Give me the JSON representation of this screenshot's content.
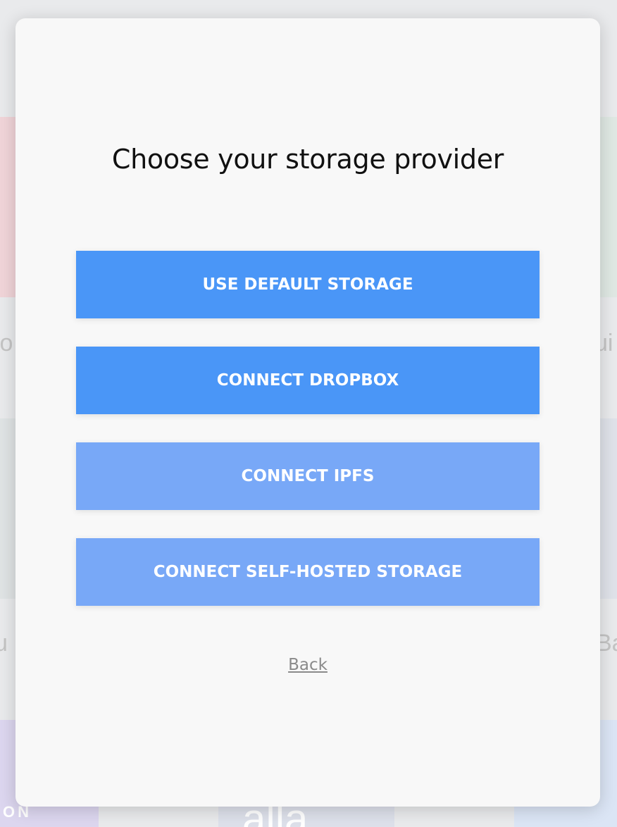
{
  "background": {
    "left_fragment_1": "lo",
    "right_fragment_1": "ui",
    "left_fragment_2": "u",
    "right_fragment_2": "Ba",
    "bottom_left_logo": "ON",
    "bottom_center_logo": "alla"
  },
  "modal": {
    "title": "Choose your storage provider",
    "buttons": [
      {
        "label": "USE DEFAULT STORAGE",
        "color": "#4a96f7"
      },
      {
        "label": "CONNECT DROPBOX",
        "color": "#4a96f7"
      },
      {
        "label": "CONNECT IPFS",
        "color": "#78a8f7"
      },
      {
        "label": "CONNECT SELF-HOSTED STORAGE",
        "color": "#78a8f7"
      }
    ],
    "back_label": "Back"
  }
}
